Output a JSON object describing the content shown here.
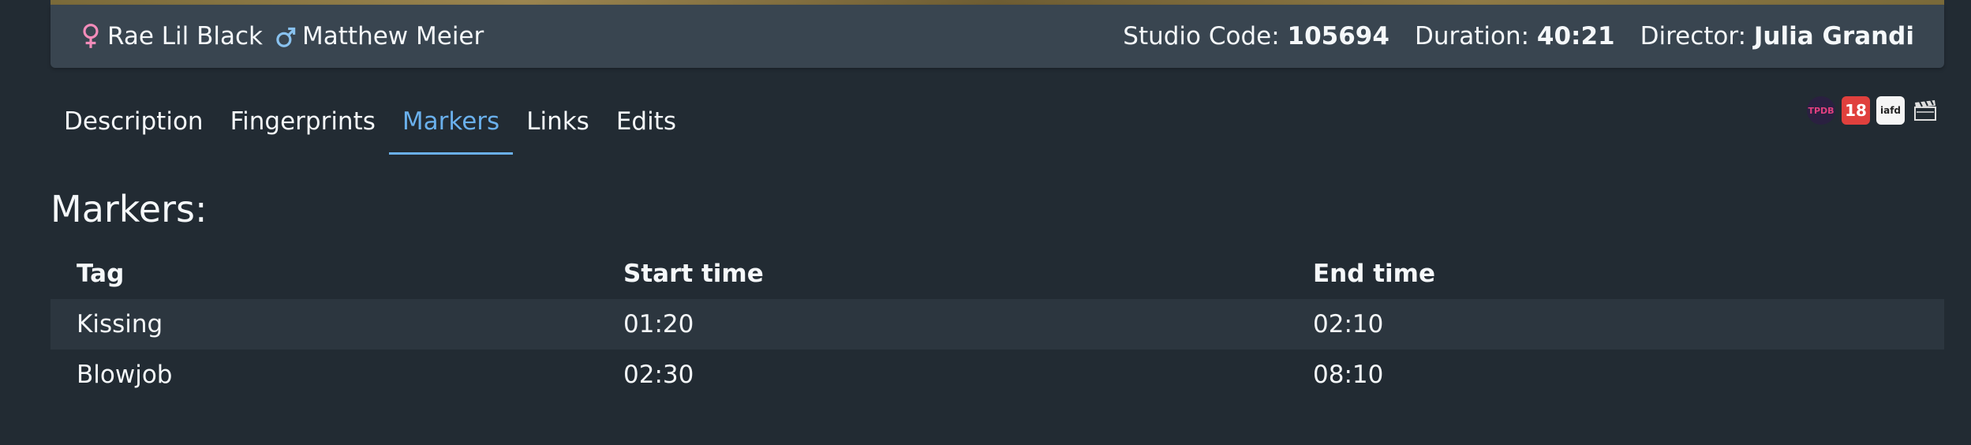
{
  "performers": [
    {
      "name": "Rae Lil Black",
      "gender": "female",
      "icon": "female-icon"
    },
    {
      "name": "Matthew Meier",
      "gender": "male",
      "icon": "male-icon"
    }
  ],
  "meta": {
    "studio_code_label": "Studio Code:",
    "studio_code": "105694",
    "duration_label": "Duration:",
    "duration": "40:21",
    "director_label": "Director:",
    "director": "Julia Grandi"
  },
  "tabs": [
    {
      "label": "Description",
      "active": false
    },
    {
      "label": "Fingerprints",
      "active": false
    },
    {
      "label": "Markers",
      "active": true
    },
    {
      "label": "Links",
      "active": false
    },
    {
      "label": "Edits",
      "active": false
    }
  ],
  "external_links": [
    {
      "icon": "tpdb-icon",
      "text": "TPDB"
    },
    {
      "icon": "r18-icon",
      "text": "18"
    },
    {
      "icon": "iafd-icon",
      "text": "iafd"
    },
    {
      "icon": "clapperboard-icon",
      "text": ""
    }
  ],
  "markers": {
    "heading": "Markers:",
    "columns": [
      "Tag",
      "Start time",
      "End time"
    ],
    "rows": [
      {
        "tag": "Kissing",
        "start": "01:20",
        "end": "02:10"
      },
      {
        "tag": "Blowjob",
        "start": "02:30",
        "end": "08:10"
      }
    ]
  },
  "colors": {
    "background": "#222b33",
    "info_bar": "#394550",
    "accent": "#6ab0ec",
    "female": "#f38cba",
    "male": "#89c2ef",
    "row_stripe": "#2c363f"
  }
}
